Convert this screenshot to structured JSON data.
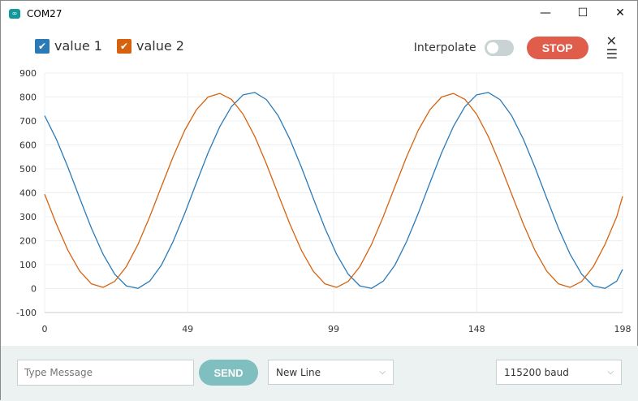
{
  "window": {
    "title": "COM27",
    "icon": "infinity-icon",
    "minimize": "—",
    "maximize": "☐",
    "close": "✕"
  },
  "legend": [
    {
      "label": "value 1",
      "color": "#2a7ab8",
      "checked": true
    },
    {
      "label": "value 2",
      "color": "#d6620f",
      "checked": true
    }
  ],
  "controls": {
    "interpolate_label": "Interpolate",
    "interpolate_on": false,
    "stop_label": "STOP",
    "clear_icon": "✕☰"
  },
  "bottom": {
    "message_placeholder": "Type Message",
    "send_label": "SEND",
    "line_ending": "New Line",
    "baud": "115200 baud"
  },
  "chart_data": {
    "type": "line",
    "ylim": [
      -100,
      900
    ],
    "xlim": [
      0,
      198
    ],
    "yticks": [
      900,
      800,
      700,
      600,
      500,
      400,
      300,
      200,
      100,
      0,
      -100
    ],
    "xticks": [
      0,
      49,
      99,
      148,
      198
    ],
    "x": [
      0,
      4,
      8,
      12,
      16,
      20,
      24,
      28,
      32,
      36,
      40,
      44,
      48,
      52,
      56,
      60,
      64,
      68,
      72,
      76,
      80,
      84,
      88,
      92,
      96,
      100,
      104,
      108,
      112,
      116,
      120,
      124,
      128,
      132,
      136,
      140,
      144,
      148,
      152,
      156,
      160,
      164,
      168,
      172,
      176,
      180,
      184,
      188,
      192,
      196,
      198
    ],
    "series": [
      {
        "name": "value 1",
        "color": "#2a7ab8",
        "values": [
          722,
          624,
          506,
          378,
          253,
          144,
          60,
          11,
          1,
          31,
          98,
          196,
          314,
          442,
          567,
          676,
          760,
          809,
          819,
          789,
          722,
          624,
          506,
          378,
          253,
          144,
          60,
          11,
          1,
          31,
          98,
          196,
          314,
          442,
          567,
          676,
          760,
          809,
          819,
          789,
          722,
          624,
          506,
          378,
          253,
          144,
          60,
          11,
          1,
          31,
          80
        ]
      },
      {
        "name": "value 2",
        "color": "#d6620f",
        "values": [
          394,
          270,
          159,
          73,
          20,
          5,
          30,
          92,
          185,
          300,
          426,
          550,
          661,
          747,
          800,
          815,
          790,
          728,
          635,
          520,
          394,
          270,
          159,
          73,
          20,
          5,
          30,
          92,
          185,
          300,
          426,
          550,
          661,
          747,
          800,
          815,
          790,
          728,
          635,
          520,
          394,
          270,
          159,
          73,
          20,
          5,
          30,
          92,
          185,
          300,
          385
        ]
      }
    ]
  }
}
